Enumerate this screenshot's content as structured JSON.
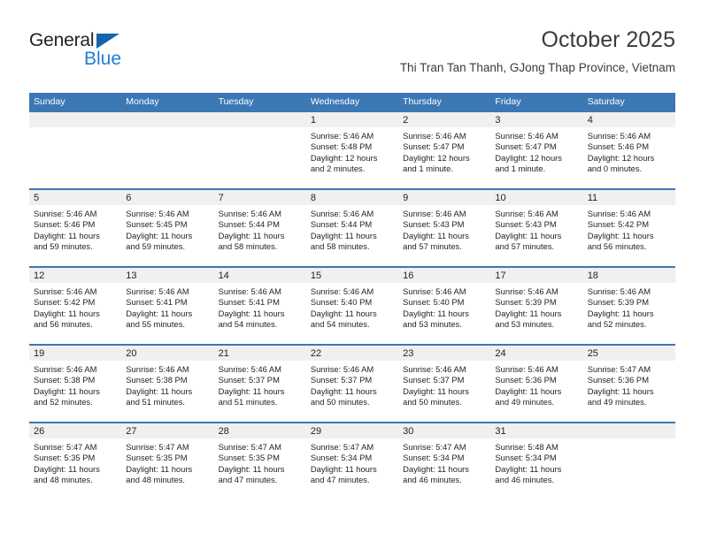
{
  "brand": {
    "name_top": "General",
    "name_bottom": "Blue",
    "accent_color": "#1f7fd4",
    "triangle_color": "#1565ab"
  },
  "header": {
    "title": "October 2025",
    "subtitle": "Thi Tran Tan Thanh, GJong Thap Province, Vietnam"
  },
  "calendar": {
    "header_bg": "#3b78b4",
    "header_text_color": "#ffffff",
    "datecell_bg": "#f0f0f0",
    "day_names": [
      "Sunday",
      "Monday",
      "Tuesday",
      "Wednesday",
      "Thursday",
      "Friday",
      "Saturday"
    ],
    "weeks": [
      [
        {
          "day": "",
          "sunrise": "",
          "sunset": "",
          "daylight1": "",
          "daylight2": ""
        },
        {
          "day": "",
          "sunrise": "",
          "sunset": "",
          "daylight1": "",
          "daylight2": ""
        },
        {
          "day": "",
          "sunrise": "",
          "sunset": "",
          "daylight1": "",
          "daylight2": ""
        },
        {
          "day": "1",
          "sunrise": "Sunrise: 5:46 AM",
          "sunset": "Sunset: 5:48 PM",
          "daylight1": "Daylight: 12 hours",
          "daylight2": "and 2 minutes."
        },
        {
          "day": "2",
          "sunrise": "Sunrise: 5:46 AM",
          "sunset": "Sunset: 5:47 PM",
          "daylight1": "Daylight: 12 hours",
          "daylight2": "and 1 minute."
        },
        {
          "day": "3",
          "sunrise": "Sunrise: 5:46 AM",
          "sunset": "Sunset: 5:47 PM",
          "daylight1": "Daylight: 12 hours",
          "daylight2": "and 1 minute."
        },
        {
          "day": "4",
          "sunrise": "Sunrise: 5:46 AM",
          "sunset": "Sunset: 5:46 PM",
          "daylight1": "Daylight: 12 hours",
          "daylight2": "and 0 minutes."
        }
      ],
      [
        {
          "day": "5",
          "sunrise": "Sunrise: 5:46 AM",
          "sunset": "Sunset: 5:46 PM",
          "daylight1": "Daylight: 11 hours",
          "daylight2": "and 59 minutes."
        },
        {
          "day": "6",
          "sunrise": "Sunrise: 5:46 AM",
          "sunset": "Sunset: 5:45 PM",
          "daylight1": "Daylight: 11 hours",
          "daylight2": "and 59 minutes."
        },
        {
          "day": "7",
          "sunrise": "Sunrise: 5:46 AM",
          "sunset": "Sunset: 5:44 PM",
          "daylight1": "Daylight: 11 hours",
          "daylight2": "and 58 minutes."
        },
        {
          "day": "8",
          "sunrise": "Sunrise: 5:46 AM",
          "sunset": "Sunset: 5:44 PM",
          "daylight1": "Daylight: 11 hours",
          "daylight2": "and 58 minutes."
        },
        {
          "day": "9",
          "sunrise": "Sunrise: 5:46 AM",
          "sunset": "Sunset: 5:43 PM",
          "daylight1": "Daylight: 11 hours",
          "daylight2": "and 57 minutes."
        },
        {
          "day": "10",
          "sunrise": "Sunrise: 5:46 AM",
          "sunset": "Sunset: 5:43 PM",
          "daylight1": "Daylight: 11 hours",
          "daylight2": "and 57 minutes."
        },
        {
          "day": "11",
          "sunrise": "Sunrise: 5:46 AM",
          "sunset": "Sunset: 5:42 PM",
          "daylight1": "Daylight: 11 hours",
          "daylight2": "and 56 minutes."
        }
      ],
      [
        {
          "day": "12",
          "sunrise": "Sunrise: 5:46 AM",
          "sunset": "Sunset: 5:42 PM",
          "daylight1": "Daylight: 11 hours",
          "daylight2": "and 56 minutes."
        },
        {
          "day": "13",
          "sunrise": "Sunrise: 5:46 AM",
          "sunset": "Sunset: 5:41 PM",
          "daylight1": "Daylight: 11 hours",
          "daylight2": "and 55 minutes."
        },
        {
          "day": "14",
          "sunrise": "Sunrise: 5:46 AM",
          "sunset": "Sunset: 5:41 PM",
          "daylight1": "Daylight: 11 hours",
          "daylight2": "and 54 minutes."
        },
        {
          "day": "15",
          "sunrise": "Sunrise: 5:46 AM",
          "sunset": "Sunset: 5:40 PM",
          "daylight1": "Daylight: 11 hours",
          "daylight2": "and 54 minutes."
        },
        {
          "day": "16",
          "sunrise": "Sunrise: 5:46 AM",
          "sunset": "Sunset: 5:40 PM",
          "daylight1": "Daylight: 11 hours",
          "daylight2": "and 53 minutes."
        },
        {
          "day": "17",
          "sunrise": "Sunrise: 5:46 AM",
          "sunset": "Sunset: 5:39 PM",
          "daylight1": "Daylight: 11 hours",
          "daylight2": "and 53 minutes."
        },
        {
          "day": "18",
          "sunrise": "Sunrise: 5:46 AM",
          "sunset": "Sunset: 5:39 PM",
          "daylight1": "Daylight: 11 hours",
          "daylight2": "and 52 minutes."
        }
      ],
      [
        {
          "day": "19",
          "sunrise": "Sunrise: 5:46 AM",
          "sunset": "Sunset: 5:38 PM",
          "daylight1": "Daylight: 11 hours",
          "daylight2": "and 52 minutes."
        },
        {
          "day": "20",
          "sunrise": "Sunrise: 5:46 AM",
          "sunset": "Sunset: 5:38 PM",
          "daylight1": "Daylight: 11 hours",
          "daylight2": "and 51 minutes."
        },
        {
          "day": "21",
          "sunrise": "Sunrise: 5:46 AM",
          "sunset": "Sunset: 5:37 PM",
          "daylight1": "Daylight: 11 hours",
          "daylight2": "and 51 minutes."
        },
        {
          "day": "22",
          "sunrise": "Sunrise: 5:46 AM",
          "sunset": "Sunset: 5:37 PM",
          "daylight1": "Daylight: 11 hours",
          "daylight2": "and 50 minutes."
        },
        {
          "day": "23",
          "sunrise": "Sunrise: 5:46 AM",
          "sunset": "Sunset: 5:37 PM",
          "daylight1": "Daylight: 11 hours",
          "daylight2": "and 50 minutes."
        },
        {
          "day": "24",
          "sunrise": "Sunrise: 5:46 AM",
          "sunset": "Sunset: 5:36 PM",
          "daylight1": "Daylight: 11 hours",
          "daylight2": "and 49 minutes."
        },
        {
          "day": "25",
          "sunrise": "Sunrise: 5:47 AM",
          "sunset": "Sunset: 5:36 PM",
          "daylight1": "Daylight: 11 hours",
          "daylight2": "and 49 minutes."
        }
      ],
      [
        {
          "day": "26",
          "sunrise": "Sunrise: 5:47 AM",
          "sunset": "Sunset: 5:35 PM",
          "daylight1": "Daylight: 11 hours",
          "daylight2": "and 48 minutes."
        },
        {
          "day": "27",
          "sunrise": "Sunrise: 5:47 AM",
          "sunset": "Sunset: 5:35 PM",
          "daylight1": "Daylight: 11 hours",
          "daylight2": "and 48 minutes."
        },
        {
          "day": "28",
          "sunrise": "Sunrise: 5:47 AM",
          "sunset": "Sunset: 5:35 PM",
          "daylight1": "Daylight: 11 hours",
          "daylight2": "and 47 minutes."
        },
        {
          "day": "29",
          "sunrise": "Sunrise: 5:47 AM",
          "sunset": "Sunset: 5:34 PM",
          "daylight1": "Daylight: 11 hours",
          "daylight2": "and 47 minutes."
        },
        {
          "day": "30",
          "sunrise": "Sunrise: 5:47 AM",
          "sunset": "Sunset: 5:34 PM",
          "daylight1": "Daylight: 11 hours",
          "daylight2": "and 46 minutes."
        },
        {
          "day": "31",
          "sunrise": "Sunrise: 5:48 AM",
          "sunset": "Sunset: 5:34 PM",
          "daylight1": "Daylight: 11 hours",
          "daylight2": "and 46 minutes."
        },
        {
          "day": "",
          "sunrise": "",
          "sunset": "",
          "daylight1": "",
          "daylight2": ""
        }
      ]
    ]
  }
}
